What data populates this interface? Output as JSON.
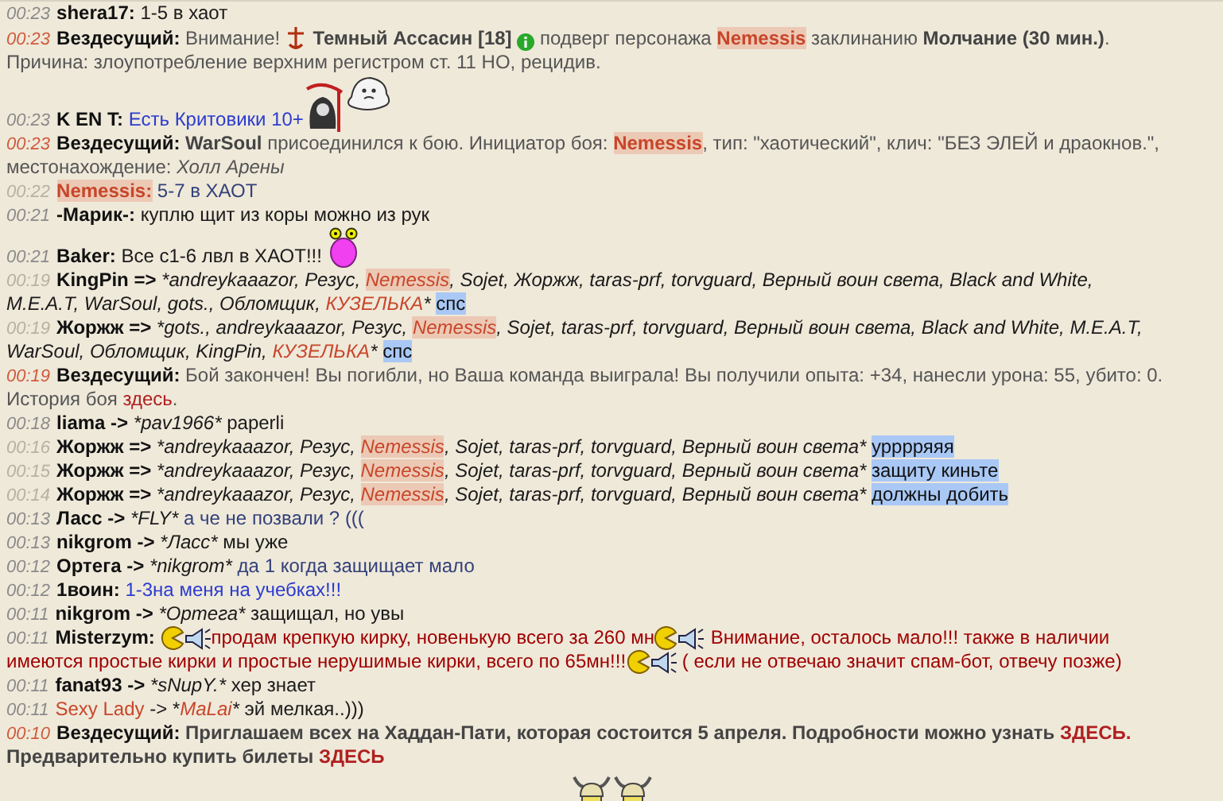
{
  "messages": [
    {
      "kind": "normal",
      "time": "00:23",
      "segments": [
        {
          "kind": "sender",
          "text": "shera17:"
        },
        {
          "kind": "text",
          "text": " 1-5 в хаот"
        }
      ]
    },
    {
      "kind": "system",
      "time": "00:23",
      "segments": [
        {
          "kind": "sender",
          "text": "Вездесущий:"
        },
        {
          "kind": "sys",
          "text": " Внимание! "
        },
        {
          "kind": "dagger-icon"
        },
        {
          "kind": "sys-bold",
          "text": " Темный Ассасин [18] "
        },
        {
          "kind": "info-icon"
        },
        {
          "kind": "sys",
          "text": " подверг персонажа "
        },
        {
          "kind": "name-hl",
          "text": "Nemessis"
        },
        {
          "kind": "sys",
          "text": " заклинанию "
        },
        {
          "kind": "sys-bold",
          "text": "Молчание (30 мин.)"
        },
        {
          "kind": "sys",
          "text": "."
        },
        {
          "kind": "break"
        },
        {
          "kind": "sys",
          "text": "Причина: злоупотребление верхним регистром ст. 11 НО, рецидив."
        }
      ]
    },
    {
      "kind": "normal",
      "time": "00:23",
      "segments": [
        {
          "kind": "sender",
          "text": "K EN T:"
        },
        {
          "kind": "blue",
          "text": " Есть Критовики 10+"
        },
        {
          "kind": "reaper-icon"
        },
        {
          "kind": "ghost-icon"
        }
      ]
    },
    {
      "kind": "system",
      "time": "00:23",
      "segments": [
        {
          "kind": "sender",
          "text": "Вездесущий:"
        },
        {
          "kind": "sys-bold",
          "text": " WarSoul"
        },
        {
          "kind": "sys",
          "text": " присоединился к бою. Инициатор боя: "
        },
        {
          "kind": "name-hl",
          "text": "Nemessis"
        },
        {
          "kind": "sys",
          "text": ", тип: \"хаотический\", клич: \"БЕЗ ЭЛЕЙ и драокнов.\","
        },
        {
          "kind": "break"
        },
        {
          "kind": "sys",
          "text": "местонахождение: "
        },
        {
          "kind": "sys-italic",
          "text": "Холл Арены"
        }
      ]
    },
    {
      "kind": "faint",
      "time": "00:22",
      "segments": [
        {
          "kind": "sender-hl",
          "text": "Nemessis:"
        },
        {
          "kind": "navy",
          "text": " 5-7 в ХАОТ"
        }
      ]
    },
    {
      "kind": "normal",
      "time": "00:21",
      "segments": [
        {
          "kind": "sender",
          "text": "-Марик-:"
        },
        {
          "kind": "text",
          "text": " куплю щит из коры можно из рук"
        }
      ]
    },
    {
      "kind": "normal",
      "time": "00:21",
      "segments": [
        {
          "kind": "sender",
          "text": "Baker:"
        },
        {
          "kind": "text",
          "text": " Все с1-6 лвл в ХАОТ!!! "
        },
        {
          "kind": "blob-icon"
        }
      ]
    },
    {
      "kind": "faint",
      "time": "00:19",
      "segments": [
        {
          "kind": "sender",
          "text": "KingPin =>"
        },
        {
          "kind": "to",
          "text": " *andreykaaazor, Резус, "
        },
        {
          "kind": "to-hl",
          "text": "Nemessis"
        },
        {
          "kind": "to",
          "text": ", Sojet, Жоржж, taras-prf, torvguard, Верный воин света, Black and White,"
        },
        {
          "kind": "break"
        },
        {
          "kind": "to",
          "text": "M.E.A.T, WarSoul, gots., Обломщик, "
        },
        {
          "kind": "to-red",
          "text": "КУЗЕЛЬКА"
        },
        {
          "kind": "to",
          "text": "* "
        },
        {
          "kind": "sel",
          "text": "спс"
        }
      ]
    },
    {
      "kind": "faint",
      "time": "00:19",
      "segments": [
        {
          "kind": "sender",
          "text": "Жоржж =>"
        },
        {
          "kind": "to",
          "text": " *gots., andreykaaazor, Резус, "
        },
        {
          "kind": "to-hl",
          "text": "Nemessis"
        },
        {
          "kind": "to",
          "text": ", Sojet, taras-prf, torvguard, Верный воин света, Black and White, M.E.A.T,"
        },
        {
          "kind": "break"
        },
        {
          "kind": "to",
          "text": "WarSoul, Обломщик, KingPin, "
        },
        {
          "kind": "to-red",
          "text": "КУЗЕЛЬКА"
        },
        {
          "kind": "to",
          "text": "* "
        },
        {
          "kind": "sel",
          "text": "спс"
        }
      ]
    },
    {
      "kind": "system",
      "time": "00:19",
      "segments": [
        {
          "kind": "sender",
          "text": "Вездесущий:"
        },
        {
          "kind": "sys",
          "text": " Бой закончен! Вы погибли, но Ваша команда выиграла! Вы получили опыта: +34, нанесли урона: 55, убито: 0."
        },
        {
          "kind": "break"
        },
        {
          "kind": "sys",
          "text": "История боя "
        },
        {
          "kind": "link",
          "text": "здесь"
        },
        {
          "kind": "sys",
          "text": "."
        }
      ]
    },
    {
      "kind": "normal",
      "time": "00:18",
      "segments": [
        {
          "kind": "sender",
          "text": "liama ->"
        },
        {
          "kind": "to",
          "text": " *pav1966*"
        },
        {
          "kind": "text",
          "text": " paperli"
        }
      ]
    },
    {
      "kind": "faint",
      "time": "00:16",
      "segments": [
        {
          "kind": "sender",
          "text": "Жоржж =>"
        },
        {
          "kind": "to",
          "text": " *andreykaaazor, Резус, "
        },
        {
          "kind": "to-hl",
          "text": "Nemessis"
        },
        {
          "kind": "to",
          "text": ", Sojet, taras-prf, torvguard, Верный воин света* "
        },
        {
          "kind": "sel",
          "text": "урррряяя"
        }
      ]
    },
    {
      "kind": "faint",
      "time": "00:15",
      "segments": [
        {
          "kind": "sender",
          "text": "Жоржж =>"
        },
        {
          "kind": "to",
          "text": " *andreykaaazor, Резус, "
        },
        {
          "kind": "to-hl",
          "text": "Nemessis"
        },
        {
          "kind": "to",
          "text": ", Sojet, taras-prf, torvguard, Верный воин света* "
        },
        {
          "kind": "sel",
          "text": "защиту киньте"
        }
      ]
    },
    {
      "kind": "faint",
      "time": "00:14",
      "segments": [
        {
          "kind": "sender",
          "text": "Жоржж =>"
        },
        {
          "kind": "to",
          "text": " *andreykaaazor, Резус, "
        },
        {
          "kind": "to-hl",
          "text": "Nemessis"
        },
        {
          "kind": "to",
          "text": ", Sojet, taras-prf, torvguard, Верный воин света* "
        },
        {
          "kind": "sel",
          "text": "должны добить"
        }
      ]
    },
    {
      "kind": "normal",
      "time": "00:13",
      "segments": [
        {
          "kind": "sender",
          "text": "Ласс ->"
        },
        {
          "kind": "to",
          "text": " *FLY*"
        },
        {
          "kind": "navy",
          "text": " а че не позвали ? ((("
        }
      ]
    },
    {
      "kind": "normal",
      "time": "00:13",
      "segments": [
        {
          "kind": "sender",
          "text": "nikgrom ->"
        },
        {
          "kind": "to",
          "text": " *Ласс*"
        },
        {
          "kind": "text",
          "text": " мы уже"
        }
      ]
    },
    {
      "kind": "normal",
      "time": "00:12",
      "segments": [
        {
          "kind": "sender",
          "text": "Ортега ->"
        },
        {
          "kind": "to",
          "text": " *nikgrom*"
        },
        {
          "kind": "navy",
          "text": " да 1 когда защищает мало"
        }
      ]
    },
    {
      "kind": "normal",
      "time": "00:12",
      "segments": [
        {
          "kind": "sender",
          "text": "1воин:"
        },
        {
          "kind": "blue",
          "text": " 1-3на меня на учебках!!!"
        }
      ]
    },
    {
      "kind": "normal",
      "time": "00:11",
      "segments": [
        {
          "kind": "sender",
          "text": "nikgrom ->"
        },
        {
          "kind": "to",
          "text": " *Ортега*"
        },
        {
          "kind": "text",
          "text": " защищал, но увы"
        }
      ]
    },
    {
      "kind": "normal",
      "time": "00:11",
      "segments": [
        {
          "kind": "sender",
          "text": "Misterzym: "
        },
        {
          "kind": "pacman-icon"
        },
        {
          "kind": "horn-icon"
        },
        {
          "kind": "ad",
          "text": "продам крепкую кирку, новенькую всего за 260 мн"
        },
        {
          "kind": "pacman-icon"
        },
        {
          "kind": "horn-icon"
        },
        {
          "kind": "ad",
          "text": " Внимание, осталось мало!!! также в наличии"
        },
        {
          "kind": "break"
        },
        {
          "kind": "ad",
          "text": "имеются простые кирки и простые нерушимые кирки, всего по 65мн!!!"
        },
        {
          "kind": "pacman-icon"
        },
        {
          "kind": "horn-icon"
        },
        {
          "kind": "ad",
          "text": " ( если не отвечаю значит спам-бот, отвечу позже)"
        }
      ]
    },
    {
      "kind": "normal",
      "time": "00:11",
      "segments": [
        {
          "kind": "sender",
          "text": "fanat93 ->"
        },
        {
          "kind": "to",
          "text": " *sNupY.*"
        },
        {
          "kind": "text",
          "text": " хер знает"
        }
      ]
    },
    {
      "kind": "normal",
      "time": "00:11",
      "segments": [
        {
          "kind": "sender-red",
          "text": "Sexy Lady"
        },
        {
          "kind": "text",
          "text": " -> *"
        },
        {
          "kind": "to-red",
          "text": "MaLai"
        },
        {
          "kind": "to",
          "text": "*"
        },
        {
          "kind": "text",
          "text": " эй мелкая..)))"
        }
      ]
    },
    {
      "kind": "system",
      "time": "00:10",
      "segments": [
        {
          "kind": "sender",
          "text": "Вездесущий:"
        },
        {
          "kind": "sys-bold",
          "text": " Приглашаем всех на Хаддан-Пати, которая состоится 5 апреля. Подробности можно узнать "
        },
        {
          "kind": "link-bold",
          "text": "ЗДЕСЬ."
        },
        {
          "kind": "break"
        },
        {
          "kind": "sys-bold",
          "text": "Предварительно купить билеты "
        },
        {
          "kind": "link-bold",
          "text": "ЗДЕСЬ"
        }
      ]
    },
    {
      "kind": "emotes",
      "segments": [
        {
          "kind": "helmet-icon"
        },
        {
          "kind": "helmet-icon"
        }
      ]
    }
  ]
}
